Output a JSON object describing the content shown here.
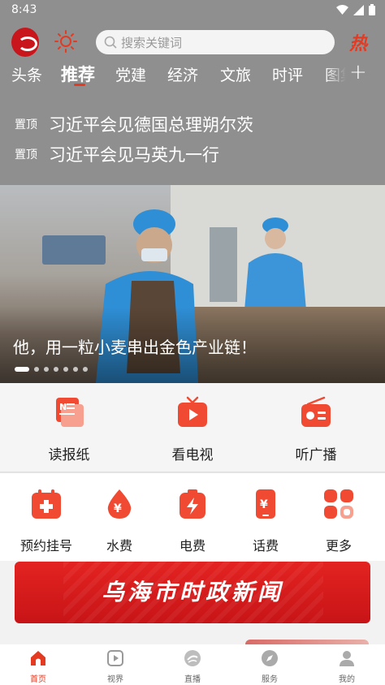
{
  "status_bar": {
    "time": "8:43"
  },
  "header": {
    "search_placeholder": "搜索关键词",
    "hot_label": "热"
  },
  "tabs": [
    "头条",
    "推荐",
    "党建",
    "经济",
    "文旅",
    "时评",
    "图集"
  ],
  "active_tab": "推荐",
  "pinned": [
    {
      "badge": "置顶",
      "title": "习近平会见德国总理朔尔茨"
    },
    {
      "badge": "置顶",
      "title": "习近平会见马英九一行"
    }
  ],
  "banner": {
    "caption": "他，用一粒小麦串出金色产业链！",
    "slide_count": 7,
    "active_slide": 1
  },
  "quick_links": [
    {
      "label": "读报纸",
      "icon": "newspaper-icon"
    },
    {
      "label": "看电视",
      "icon": "tv-icon"
    },
    {
      "label": "听广播",
      "icon": "radio-icon"
    }
  ],
  "services": [
    {
      "label": "预约挂号",
      "icon": "hospital-icon"
    },
    {
      "label": "水费",
      "icon": "water-drop-icon"
    },
    {
      "label": "电费",
      "icon": "electricity-icon"
    },
    {
      "label": "话费",
      "icon": "phone-bill-icon"
    },
    {
      "label": "更多",
      "icon": "more-grid-icon"
    }
  ],
  "news_banner": {
    "title": "乌海市时政新闻"
  },
  "bottom_nav": [
    {
      "label": "首页",
      "icon": "home-icon",
      "active": true
    },
    {
      "label": "视界",
      "icon": "video-icon",
      "active": false
    },
    {
      "label": "直播",
      "icon": "live-icon",
      "active": false
    },
    {
      "label": "服务",
      "icon": "compass-icon",
      "active": false
    },
    {
      "label": "我的",
      "icon": "profile-icon",
      "active": false
    }
  ],
  "colors": {
    "accent": "#e53a22",
    "header_bg": "#8f8f8f",
    "service_red": "#f04a32"
  }
}
